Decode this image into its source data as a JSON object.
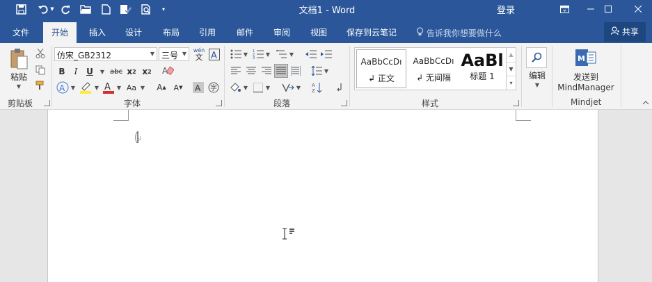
{
  "titlebar": {
    "doc_title": "文档1 - Word",
    "login": "登录"
  },
  "tabs": [
    {
      "label": "文件"
    },
    {
      "label": "开始"
    },
    {
      "label": "插入"
    },
    {
      "label": "设计"
    },
    {
      "label": "布局"
    },
    {
      "label": "引用"
    },
    {
      "label": "邮件"
    },
    {
      "label": "审阅"
    },
    {
      "label": "视图"
    },
    {
      "label": "保存到云笔记"
    }
  ],
  "tellme": "告诉我你想要做什么",
  "share": "共享",
  "clipboard": {
    "paste": "粘贴",
    "group": "剪贴板"
  },
  "font": {
    "name": "仿宋_GB2312",
    "size": "三号",
    "group": "字体",
    "wen": "wén",
    "wen_char": "文"
  },
  "paragraph": {
    "group": "段落"
  },
  "styles": {
    "group": "样式",
    "items": [
      {
        "sample": "AaBbCcDı",
        "name": "↲ 正文"
      },
      {
        "sample": "AaBbCcDı",
        "name": "↲ 无间隔"
      },
      {
        "sample": "AaBl",
        "name": "标题 1"
      }
    ]
  },
  "editing": {
    "label": "编辑"
  },
  "mindjet": {
    "label1": "发送到",
    "label2": "MindManager",
    "group": "Mindjet"
  }
}
